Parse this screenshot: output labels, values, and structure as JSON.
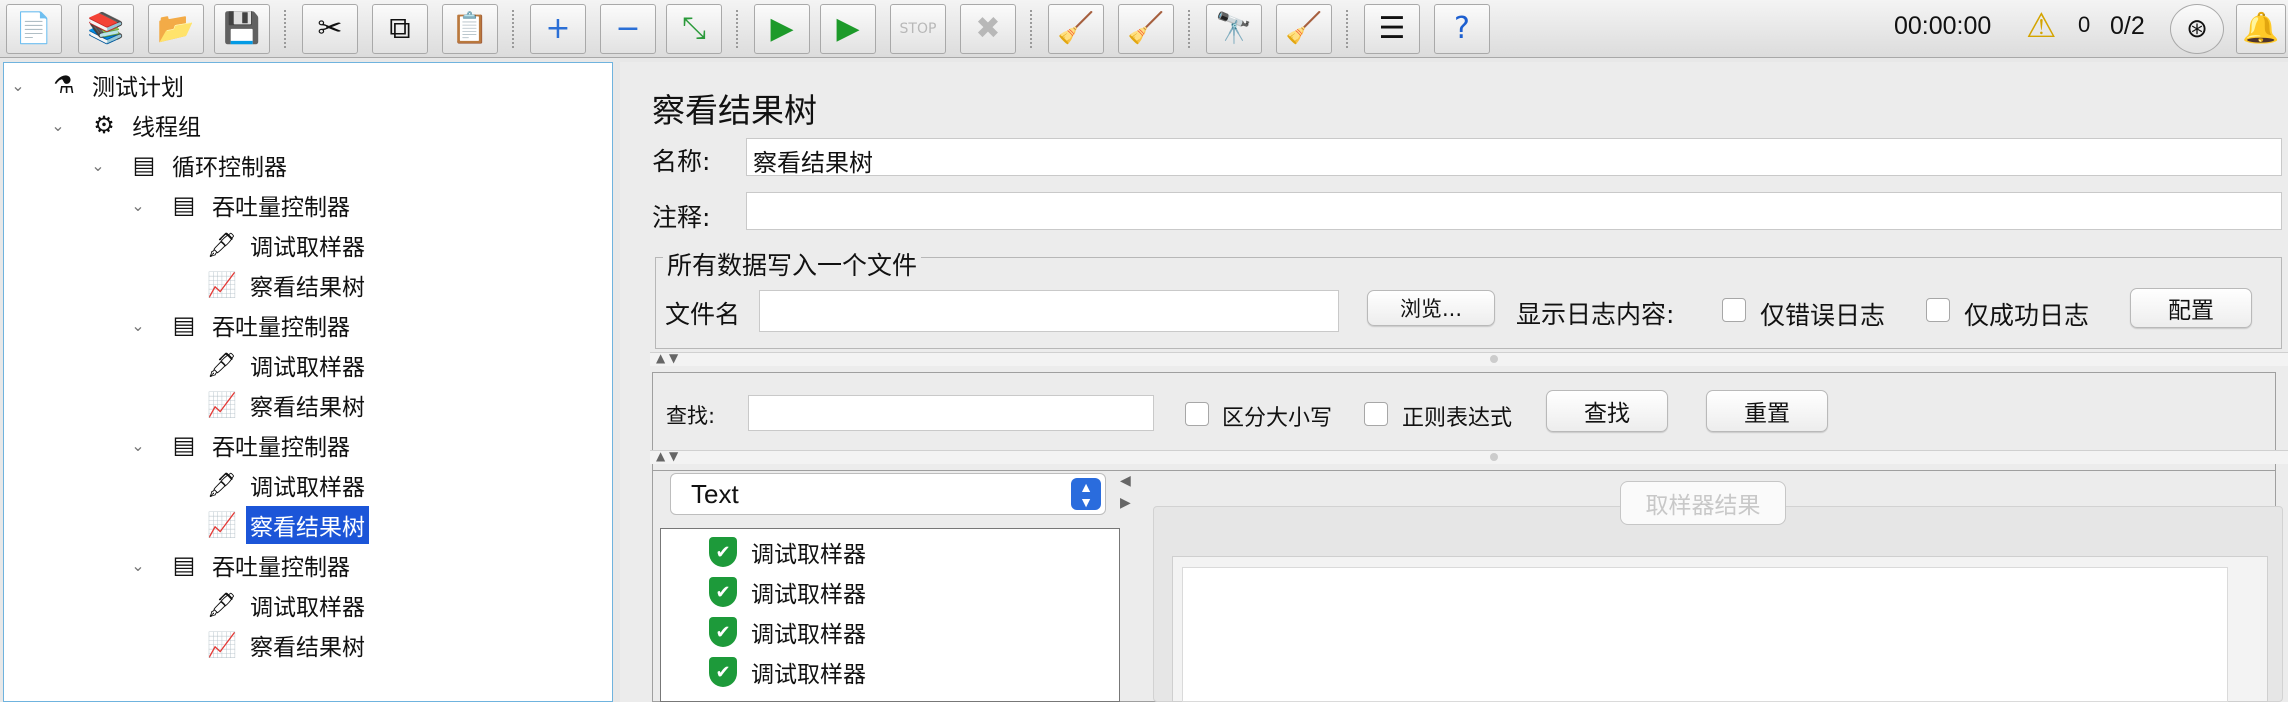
{
  "toolbar": {
    "timer": "00:00:00",
    "warning_count": "0",
    "thread_ratio": "0/2"
  },
  "tree": {
    "nodes": [
      {
        "label": "测试计划"
      },
      {
        "label": "线程组"
      },
      {
        "label": "循环控制器"
      },
      {
        "label": "吞吐量控制器"
      },
      {
        "label": "调试取样器"
      },
      {
        "label": "察看结果树"
      },
      {
        "label": "吞吐量控制器"
      },
      {
        "label": "调试取样器"
      },
      {
        "label": "察看结果树"
      },
      {
        "label": "吞吐量控制器"
      },
      {
        "label": "调试取样器"
      },
      {
        "label": "察看结果树"
      },
      {
        "label": "吞吐量控制器"
      },
      {
        "label": "调试取样器"
      },
      {
        "label": "察看结果树"
      }
    ]
  },
  "panel": {
    "title": "察看结果树",
    "name_label": "名称:",
    "name_value": "察看结果树",
    "comment_label": "注释:",
    "comment_value": "",
    "file_group_title": "所有数据写入一个文件",
    "filename_label": "文件名",
    "filename_value": "",
    "browse_button": "浏览...",
    "log_content_label": "显示日志内容:",
    "errors_only": "仅错误日志",
    "success_only": "仅成功日志",
    "configure_button": "配置"
  },
  "search": {
    "label": "查找:",
    "value": "",
    "case_sensitive": "区分大小写",
    "regex": "正则表达式",
    "find_button": "查找",
    "reset_button": "重置"
  },
  "results": {
    "renderer": "Text",
    "items": [
      {
        "label": "调试取样器"
      },
      {
        "label": "调试取样器"
      },
      {
        "label": "调试取样器"
      },
      {
        "label": "调试取样器"
      }
    ],
    "sampler_result_tab": "取样器结果"
  }
}
